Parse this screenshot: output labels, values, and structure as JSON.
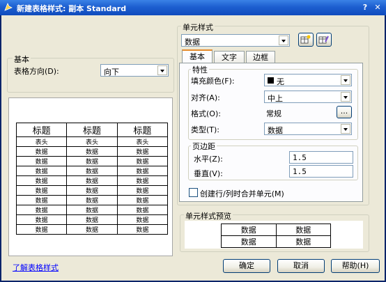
{
  "window": {
    "title": "新建表格样式: 副本 Standard",
    "help_glyph": "?",
    "close_glyph": "✕"
  },
  "basic": {
    "group_label": "基本",
    "direction_label": "表格方向(D):",
    "direction_value": "向下"
  },
  "table_preview": {
    "header": [
      "标题",
      "标题",
      "标题"
    ],
    "subheader": [
      "表头",
      "表头",
      "表头"
    ],
    "rows": [
      [
        "数据",
        "数据",
        "数据"
      ],
      [
        "数据",
        "数据",
        "数据"
      ],
      [
        "数据",
        "数据",
        "数据"
      ],
      [
        "数据",
        "数据",
        "数据"
      ],
      [
        "数据",
        "数据",
        "数据"
      ],
      [
        "数据",
        "数据",
        "数据"
      ],
      [
        "数据",
        "数据",
        "数据"
      ],
      [
        "数据",
        "数据",
        "数据"
      ],
      [
        "数据",
        "数据",
        "数据"
      ]
    ]
  },
  "cell_style": {
    "group_label": "单元样式",
    "selected": "数据",
    "tabs": [
      "基本",
      "文字",
      "边框"
    ],
    "properties": {
      "group_label": "特性",
      "fill_color_label": "填充颜色(F):",
      "fill_color_value": "无",
      "alignment_label": "对齐(A):",
      "alignment_value": "中上",
      "format_label": "格式(O):",
      "format_value": "常规",
      "format_button": "...",
      "type_label": "类型(T):",
      "type_value": "数据"
    },
    "margins": {
      "group_label": "页边距",
      "horizontal_label": "水平(Z):",
      "horizontal_value": "1.5",
      "vertical_label": "垂直(V):",
      "vertical_value": "1.5"
    },
    "merge_checkbox_label": "创建行/列时合并单元(M)"
  },
  "cell_preview": {
    "group_label": "单元样式预览",
    "rows": [
      [
        "数据",
        "数据"
      ],
      [
        "数据",
        "数据"
      ]
    ]
  },
  "footer": {
    "learn_link": "了解表格样式",
    "ok": "确定",
    "cancel": "取消",
    "help": "帮助(H)"
  }
}
